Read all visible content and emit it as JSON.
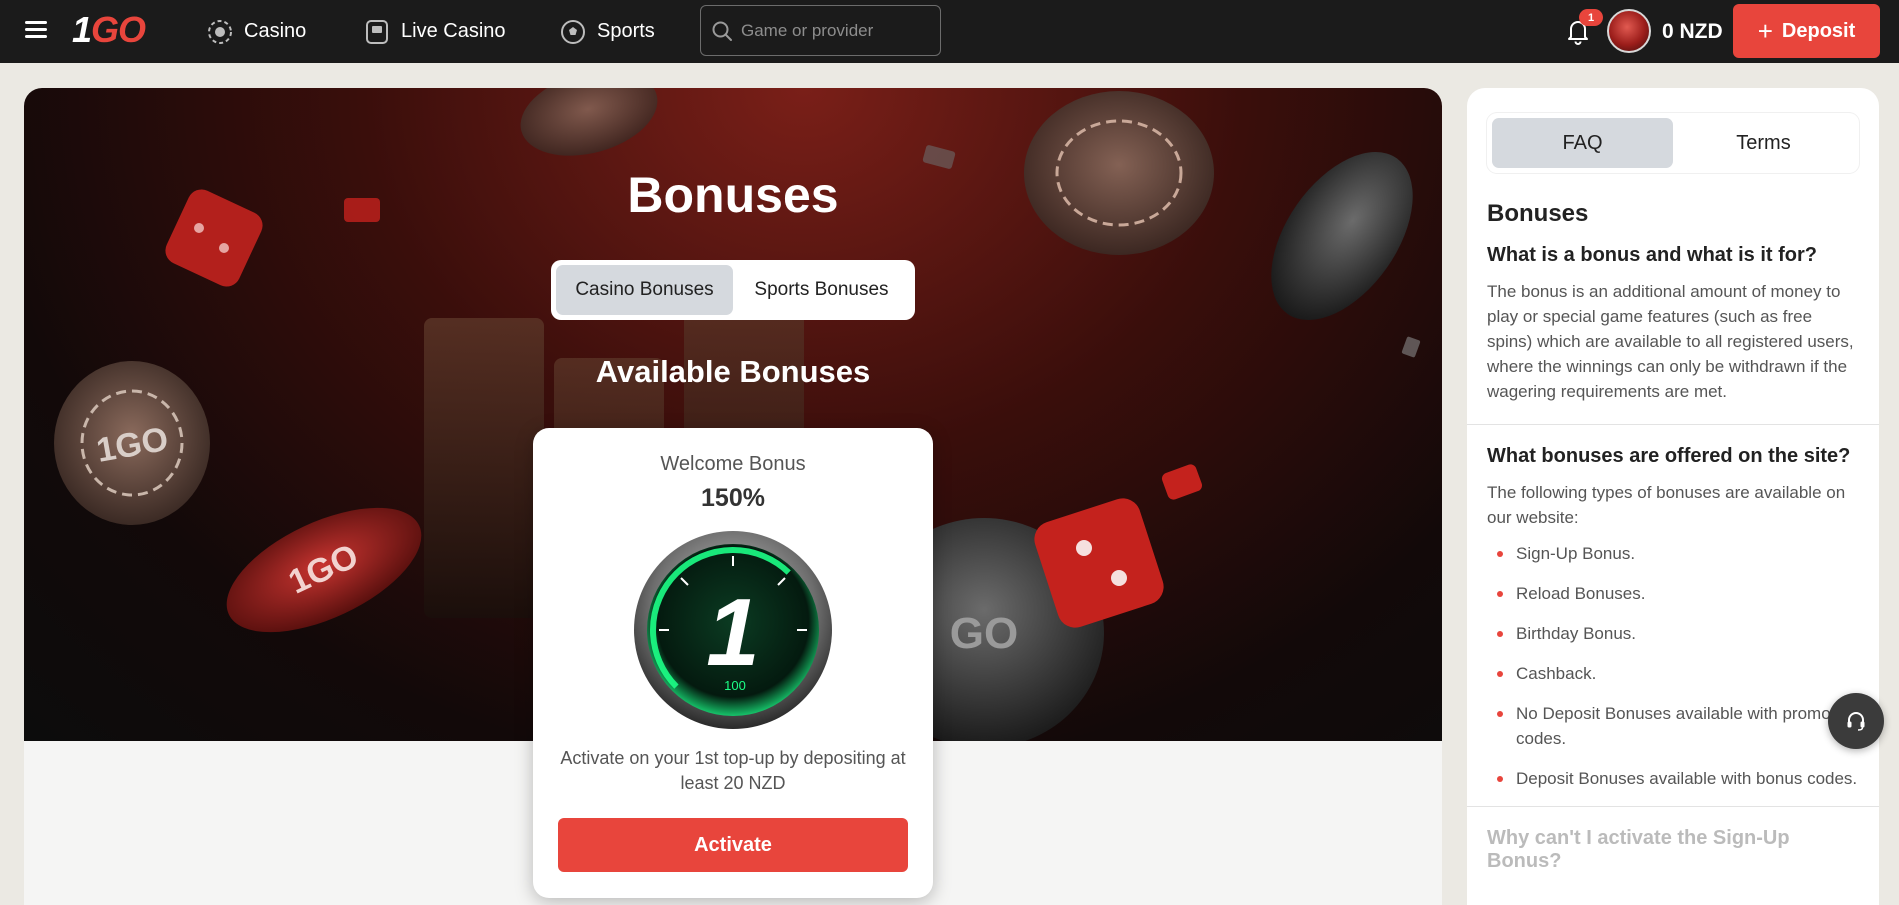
{
  "header": {
    "logo_text_one": "1",
    "logo_text_go": "GO",
    "nav": [
      {
        "label": "Casino",
        "icon": "casino-chip-icon"
      },
      {
        "label": "Live Casino",
        "icon": "live-casino-icon"
      },
      {
        "label": "Sports",
        "icon": "soccer-ball-icon"
      }
    ],
    "search_placeholder": "Game or provider",
    "notification_count": "1",
    "balance": "0 NZD",
    "deposit_label": "Deposit"
  },
  "hero": {
    "title": "Bonuses",
    "tabs": [
      {
        "label": "Casino Bonuses",
        "active": true
      },
      {
        "label": "Sports Bonuses",
        "active": false
      }
    ],
    "section_title": "Available Bonuses"
  },
  "bonus_card": {
    "label": "Welcome Bonus",
    "value": "150%",
    "image_number": "1",
    "image_gauge": "100",
    "description": "Activate on your 1st top-up by depositing at least 20 NZD",
    "button_label": "Activate"
  },
  "sidebar": {
    "tabs": [
      {
        "label": "FAQ",
        "active": true
      },
      {
        "label": "Terms",
        "active": false
      }
    ],
    "heading": "Bonuses",
    "faq": [
      {
        "question": "What is a bonus and what is it for?",
        "answer": "The bonus is an additional amount of money to play or special game features (such as free spins) which are available to all registered users, where the winnings can only be withdrawn if the wagering requirements are met."
      },
      {
        "question": "What bonuses are offered on the site?",
        "answer": "The following types of bonuses are available on our website:",
        "items": [
          "Sign-Up Bonus.",
          "Reload Bonuses.",
          "Birthday Bonus.",
          "Cashback.",
          "No Deposit Bonuses available with promo codes.",
          "Deposit Bonuses available with bonus codes."
        ]
      },
      {
        "question": "Why can't I activate the Sign-Up Bonus?"
      }
    ]
  },
  "colors": {
    "accent": "#e8453c",
    "topbar": "#1b1b1b",
    "page_bg": "#ebe9e3"
  }
}
